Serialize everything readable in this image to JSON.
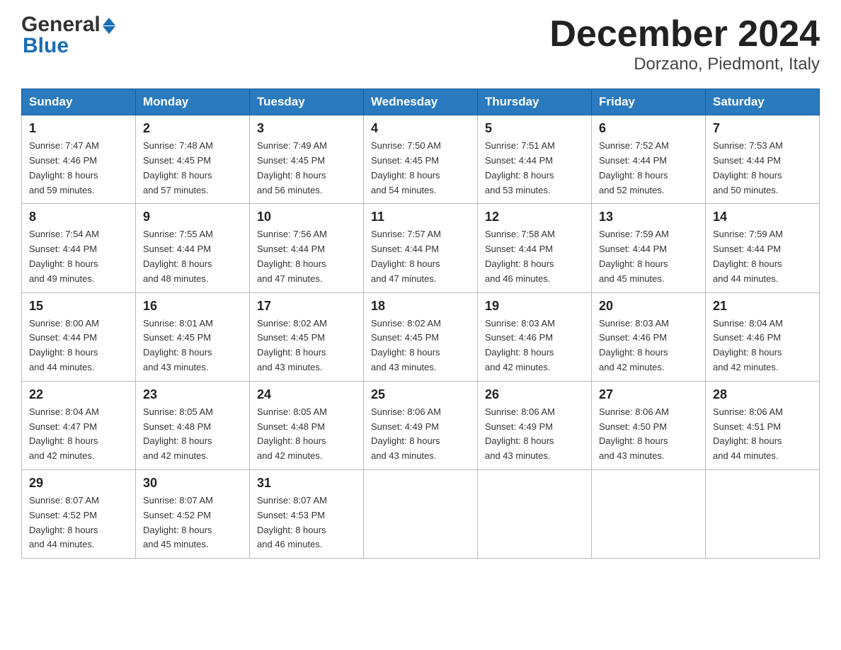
{
  "header": {
    "title": "December 2024",
    "subtitle": "Dorzano, Piedmont, Italy"
  },
  "logo": {
    "line1": "General",
    "line2": "Blue"
  },
  "days": [
    "Sunday",
    "Monday",
    "Tuesday",
    "Wednesday",
    "Thursday",
    "Friday",
    "Saturday"
  ],
  "weeks": [
    [
      {
        "num": "1",
        "sunrise": "7:47 AM",
        "sunset": "4:46 PM",
        "daylight": "8 hours and 59 minutes."
      },
      {
        "num": "2",
        "sunrise": "7:48 AM",
        "sunset": "4:45 PM",
        "daylight": "8 hours and 57 minutes."
      },
      {
        "num": "3",
        "sunrise": "7:49 AM",
        "sunset": "4:45 PM",
        "daylight": "8 hours and 56 minutes."
      },
      {
        "num": "4",
        "sunrise": "7:50 AM",
        "sunset": "4:45 PM",
        "daylight": "8 hours and 54 minutes."
      },
      {
        "num": "5",
        "sunrise": "7:51 AM",
        "sunset": "4:44 PM",
        "daylight": "8 hours and 53 minutes."
      },
      {
        "num": "6",
        "sunrise": "7:52 AM",
        "sunset": "4:44 PM",
        "daylight": "8 hours and 52 minutes."
      },
      {
        "num": "7",
        "sunrise": "7:53 AM",
        "sunset": "4:44 PM",
        "daylight": "8 hours and 50 minutes."
      }
    ],
    [
      {
        "num": "8",
        "sunrise": "7:54 AM",
        "sunset": "4:44 PM",
        "daylight": "8 hours and 49 minutes."
      },
      {
        "num": "9",
        "sunrise": "7:55 AM",
        "sunset": "4:44 PM",
        "daylight": "8 hours and 48 minutes."
      },
      {
        "num": "10",
        "sunrise": "7:56 AM",
        "sunset": "4:44 PM",
        "daylight": "8 hours and 47 minutes."
      },
      {
        "num": "11",
        "sunrise": "7:57 AM",
        "sunset": "4:44 PM",
        "daylight": "8 hours and 47 minutes."
      },
      {
        "num": "12",
        "sunrise": "7:58 AM",
        "sunset": "4:44 PM",
        "daylight": "8 hours and 46 minutes."
      },
      {
        "num": "13",
        "sunrise": "7:59 AM",
        "sunset": "4:44 PM",
        "daylight": "8 hours and 45 minutes."
      },
      {
        "num": "14",
        "sunrise": "7:59 AM",
        "sunset": "4:44 PM",
        "daylight": "8 hours and 44 minutes."
      }
    ],
    [
      {
        "num": "15",
        "sunrise": "8:00 AM",
        "sunset": "4:44 PM",
        "daylight": "8 hours and 44 minutes."
      },
      {
        "num": "16",
        "sunrise": "8:01 AM",
        "sunset": "4:45 PM",
        "daylight": "8 hours and 43 minutes."
      },
      {
        "num": "17",
        "sunrise": "8:02 AM",
        "sunset": "4:45 PM",
        "daylight": "8 hours and 43 minutes."
      },
      {
        "num": "18",
        "sunrise": "8:02 AM",
        "sunset": "4:45 PM",
        "daylight": "8 hours and 43 minutes."
      },
      {
        "num": "19",
        "sunrise": "8:03 AM",
        "sunset": "4:46 PM",
        "daylight": "8 hours and 42 minutes."
      },
      {
        "num": "20",
        "sunrise": "8:03 AM",
        "sunset": "4:46 PM",
        "daylight": "8 hours and 42 minutes."
      },
      {
        "num": "21",
        "sunrise": "8:04 AM",
        "sunset": "4:46 PM",
        "daylight": "8 hours and 42 minutes."
      }
    ],
    [
      {
        "num": "22",
        "sunrise": "8:04 AM",
        "sunset": "4:47 PM",
        "daylight": "8 hours and 42 minutes."
      },
      {
        "num": "23",
        "sunrise": "8:05 AM",
        "sunset": "4:48 PM",
        "daylight": "8 hours and 42 minutes."
      },
      {
        "num": "24",
        "sunrise": "8:05 AM",
        "sunset": "4:48 PM",
        "daylight": "8 hours and 42 minutes."
      },
      {
        "num": "25",
        "sunrise": "8:06 AM",
        "sunset": "4:49 PM",
        "daylight": "8 hours and 43 minutes."
      },
      {
        "num": "26",
        "sunrise": "8:06 AM",
        "sunset": "4:49 PM",
        "daylight": "8 hours and 43 minutes."
      },
      {
        "num": "27",
        "sunrise": "8:06 AM",
        "sunset": "4:50 PM",
        "daylight": "8 hours and 43 minutes."
      },
      {
        "num": "28",
        "sunrise": "8:06 AM",
        "sunset": "4:51 PM",
        "daylight": "8 hours and 44 minutes."
      }
    ],
    [
      {
        "num": "29",
        "sunrise": "8:07 AM",
        "sunset": "4:52 PM",
        "daylight": "8 hours and 44 minutes."
      },
      {
        "num": "30",
        "sunrise": "8:07 AM",
        "sunset": "4:52 PM",
        "daylight": "8 hours and 45 minutes."
      },
      {
        "num": "31",
        "sunrise": "8:07 AM",
        "sunset": "4:53 PM",
        "daylight": "8 hours and 46 minutes."
      },
      null,
      null,
      null,
      null
    ]
  ]
}
